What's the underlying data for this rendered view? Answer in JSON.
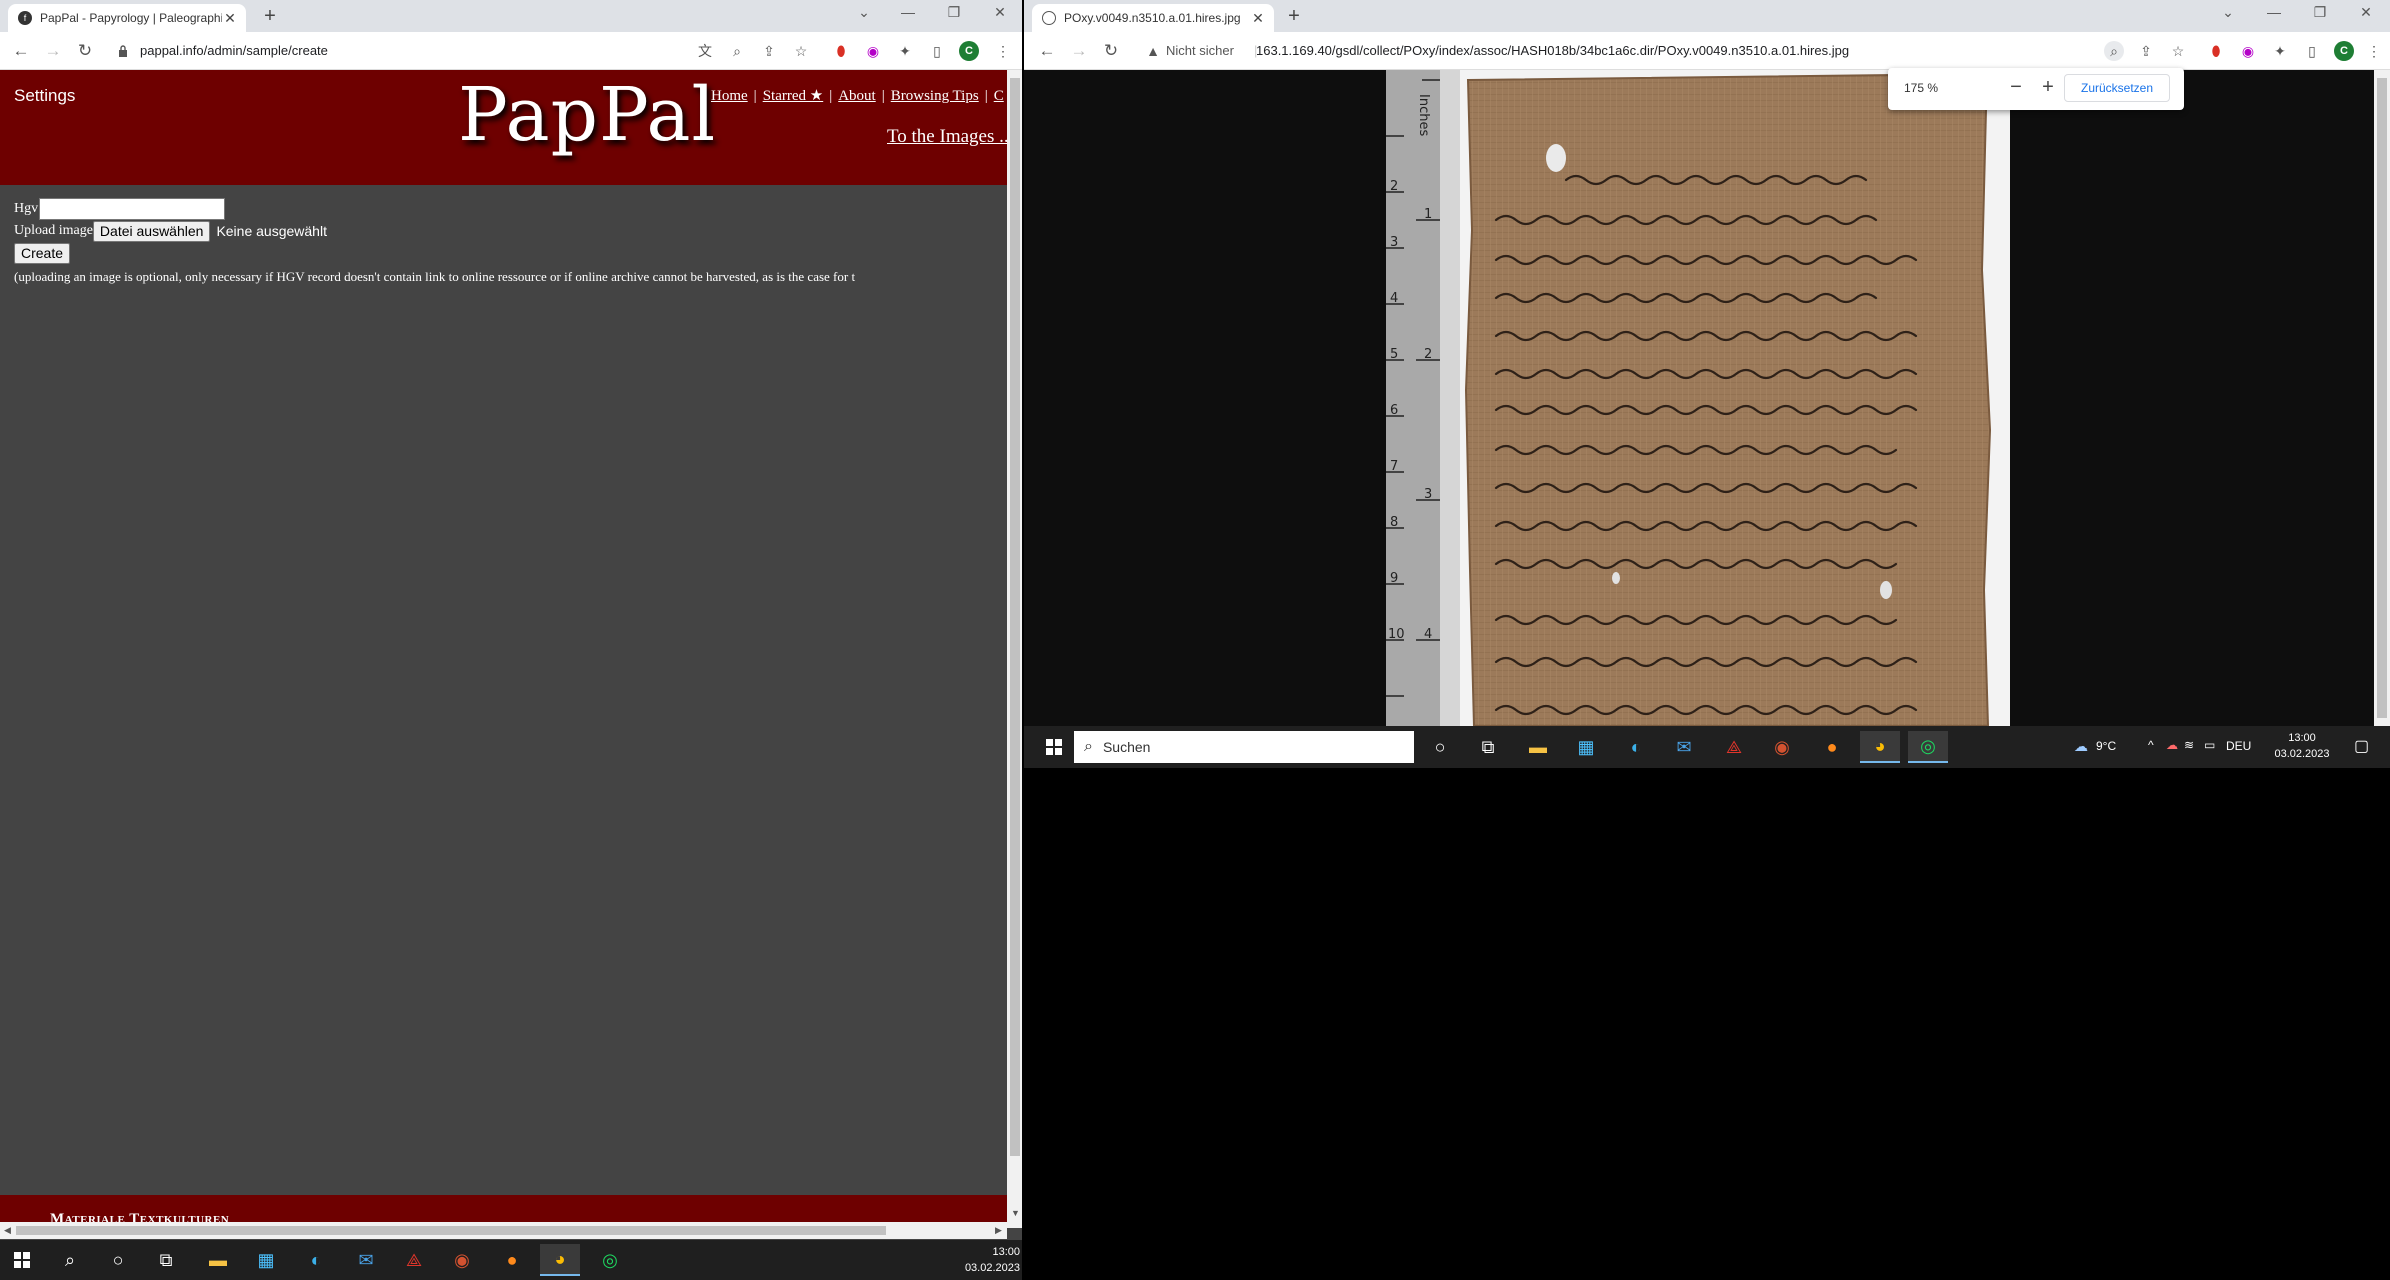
{
  "left_browser": {
    "tab_title": "PapPal - Papyrology | Paleographic",
    "url": "pappal.info/admin/sample/create",
    "page": {
      "settings_label": "Settings",
      "logo": "PapPal",
      "nav": [
        "Home",
        "Starred ★",
        "About",
        "Browsing Tips",
        "C"
      ],
      "to_images": "To the Images ...",
      "hgv_label": "Hgv",
      "hgv_value": "",
      "upload_label": "Upload image",
      "choose_file_button": "Datei auswählen",
      "no_file_text": "Keine ausgewählt",
      "create_button": "Create",
      "note": "(uploading an image is optional, only necessary if HGV record doesn't contain link to online ressource or if online archive cannot be harvested, as is the case for t",
      "footer": "Materiale Textkulturen"
    }
  },
  "right_browser": {
    "tab_title": "POxy.v0049.n3510.a.01.hires.jpg",
    "security_label": "Nicht sicher",
    "url": "163.1.169.40/gsdl/collect/POxy/index/assoc/HASH018b/34bc1a6c.dir/POxy.v0049.n3510.a.01.hires.jpg",
    "zoom_value": "175 %",
    "zoom_reset": "Zurücksetzen",
    "ruler_label": "Inches"
  },
  "left_taskbar": {
    "time": "13:00",
    "date": "03.02.2023"
  },
  "right_taskbar": {
    "search_placeholder": "Suchen",
    "weather": "9°C",
    "language": "DEU",
    "time": "13:00",
    "date": "03.02.2023"
  },
  "colors": {
    "pappal_red": "#6e0000",
    "page_gray": "#444444",
    "papyrus": "#9c7a5a",
    "link_blue": "#1a73e8"
  }
}
